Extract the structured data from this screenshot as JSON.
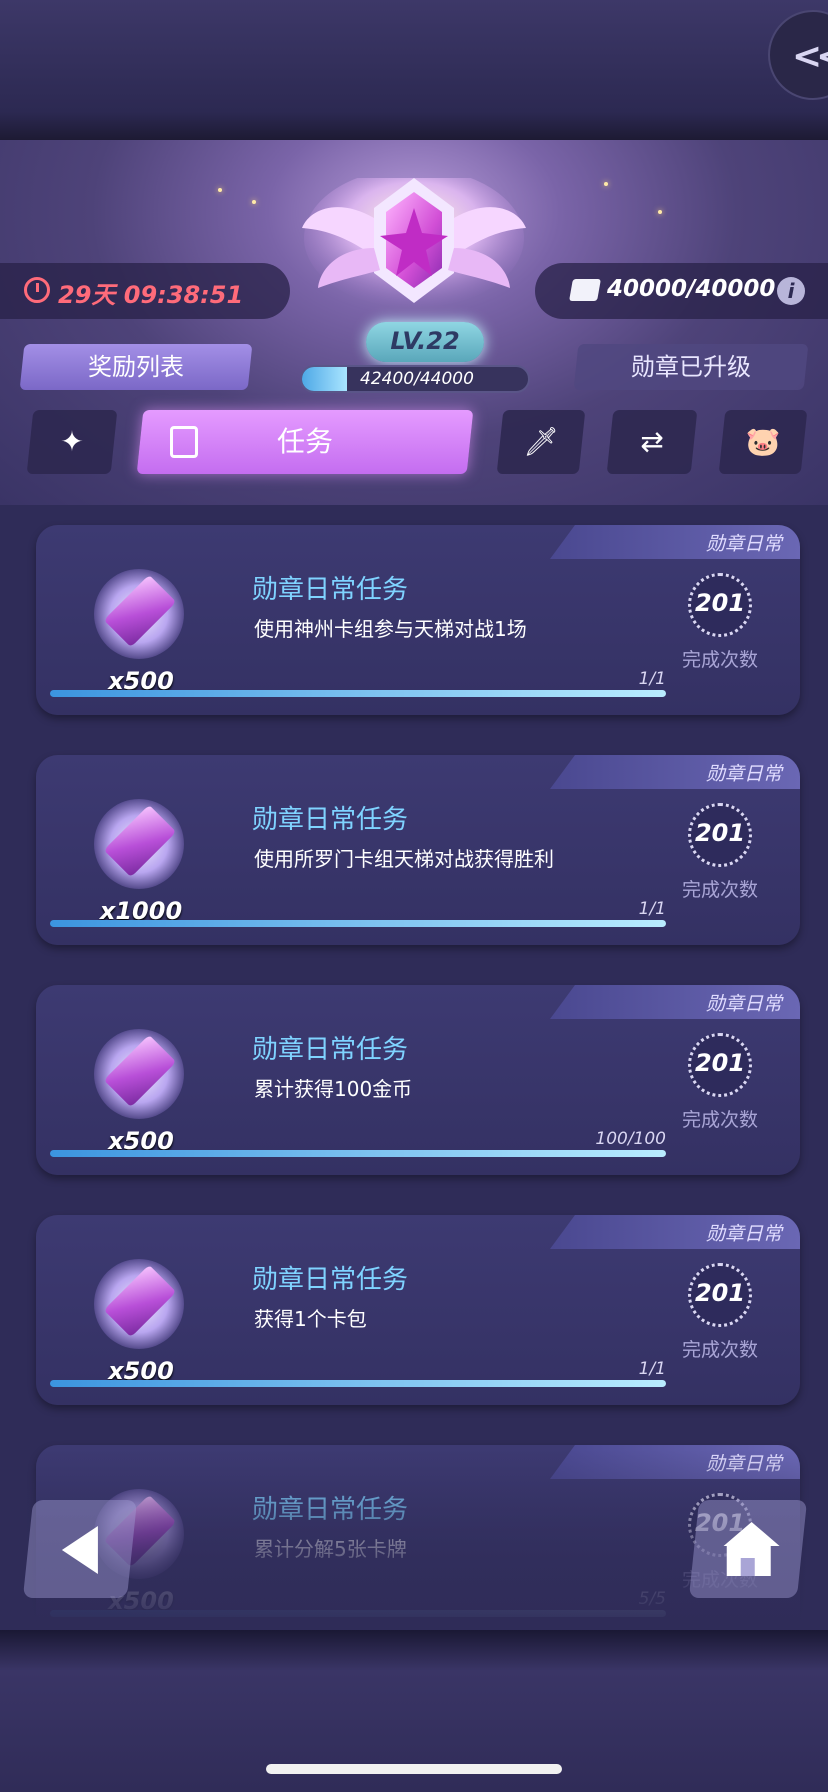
{
  "header": {
    "timer": "29天  09:38:51",
    "currency": "40000/40000",
    "level": "LV.22",
    "xp_text": "42400/44000",
    "xp_fraction": 0.2,
    "reward_list_label": "奖励列表",
    "badge_upgraded_label": "勋章已升级"
  },
  "tabs": {
    "active_label": "任务",
    "icons": [
      "emblem-icon",
      "scroll-icon",
      "sword-icon",
      "swap-icon",
      "pig-coin-icon"
    ]
  },
  "tasks": [
    {
      "tag": "勋章日常",
      "title": "勋章日常任务",
      "desc": "使用神州卡组参与天梯对战1场",
      "qty": "x500",
      "count": "201",
      "count_label": "完成次数",
      "progress_text": "1/1",
      "progress": 1.0
    },
    {
      "tag": "勋章日常",
      "title": "勋章日常任务",
      "desc": "使用所罗门卡组天梯对战获得胜利",
      "qty": "x1000",
      "count": "201",
      "count_label": "完成次数",
      "progress_text": "1/1",
      "progress": 1.0
    },
    {
      "tag": "勋章日常",
      "title": "勋章日常任务",
      "desc": "累计获得100金币",
      "qty": "x500",
      "count": "201",
      "count_label": "完成次数",
      "progress_text": "100/100",
      "progress": 1.0
    },
    {
      "tag": "勋章日常",
      "title": "勋章日常任务",
      "desc": "获得1个卡包",
      "qty": "x500",
      "count": "201",
      "count_label": "完成次数",
      "progress_text": "1/1",
      "progress": 1.0
    },
    {
      "tag": "勋章日常",
      "title": "勋章日常任务",
      "desc": "累计分解5张卡牌",
      "qty": "x500",
      "count": "201",
      "count_label": "完成次数",
      "progress_text": "5/5",
      "progress": 1.0
    }
  ],
  "colors": {
    "accent": "#c46df0",
    "title_blue": "#7fd3ff",
    "timer_red": "#ff6b7a"
  }
}
